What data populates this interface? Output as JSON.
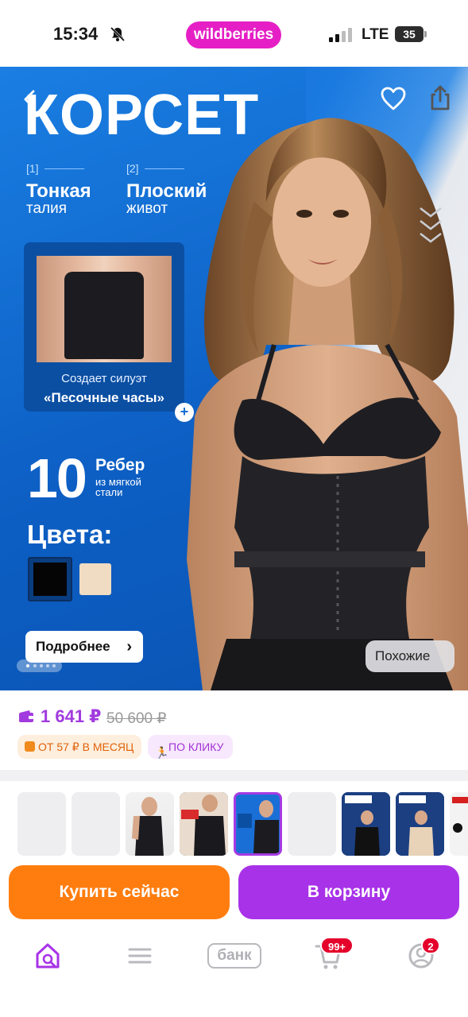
{
  "status_bar": {
    "time": "15:34",
    "app_brand": "wildberries",
    "network": "LTE",
    "battery": "35"
  },
  "hero": {
    "title": "КОРСЕТ",
    "features": [
      {
        "num": "[1]",
        "title": "Тонкая",
        "subtitle": "талия"
      },
      {
        "num": "[2]",
        "title": "Плоский",
        "subtitle": "живот"
      }
    ],
    "card": {
      "line1": "Создает силуэт",
      "line2": "«Песочные часы»"
    },
    "ribs": {
      "count": "10",
      "title": "Ребер",
      "subtitle": "из мягкой стали"
    },
    "colors_title": "Цвета:",
    "colors": [
      "#050505",
      "#efdcc2"
    ],
    "more_button": "Подробнее",
    "similar_button": "Похожие",
    "slide_index": 1,
    "slide_count": 5
  },
  "price": {
    "current": "1 641 ₽",
    "old": "50 600 ₽",
    "installment": "ОТ 57 ₽ В МЕСЯЦ",
    "one_click": "ПО КЛИКУ"
  },
  "thumbnails": {
    "selected_index": 4,
    "items": [
      "blank",
      "blank",
      "photo",
      "photo",
      "photo",
      "blank",
      "photo",
      "photo",
      "photo"
    ]
  },
  "actions": {
    "buy_now": "Купить сейчас",
    "add_to_cart": "В корзину"
  },
  "nav": {
    "bank_label": "банк",
    "cart_badge": "99+",
    "profile_badge": "2"
  },
  "colors": {
    "brand": "#e51fc5",
    "price": "#a23bdf",
    "buy_now": "#ff7d0f",
    "add_to_cart": "#a832e8"
  }
}
